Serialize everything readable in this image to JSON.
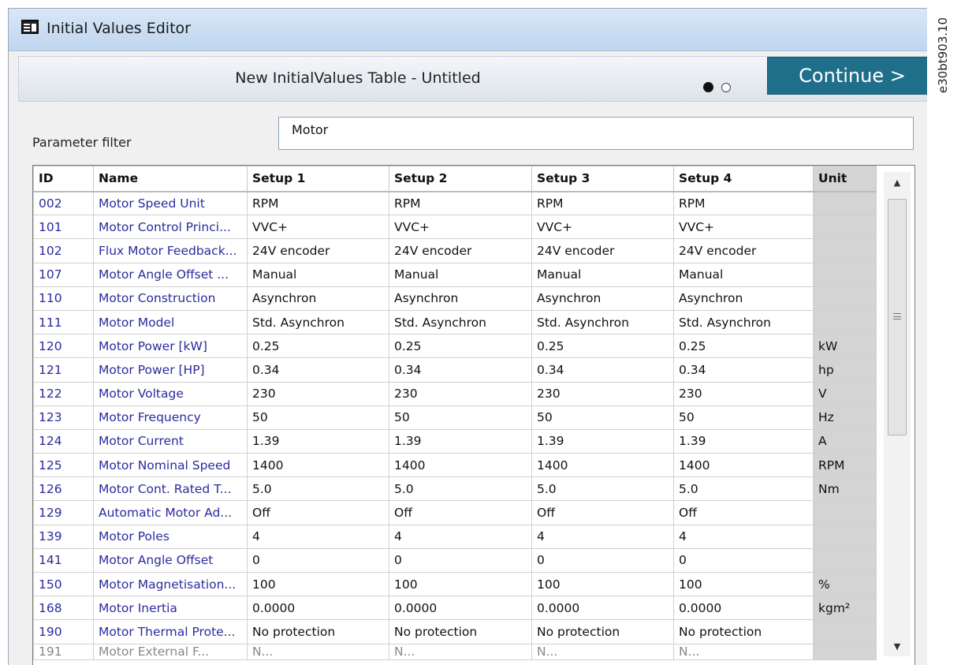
{
  "window": {
    "title": "Initial Values Editor",
    "icon": "table-app-icon"
  },
  "header": {
    "table_title": "New InitialValues Table - Untitled",
    "pagination": {
      "current_step": 1,
      "total_steps": 2
    },
    "continue_label": "Continue >",
    "continue_color": "#1f6f8b"
  },
  "filter": {
    "label": "Parameter filter",
    "value": "Motor"
  },
  "table": {
    "columns": [
      "ID",
      "Name",
      "Setup 1",
      "Setup 2",
      "Setup 3",
      "Setup 4",
      "Unit"
    ],
    "rows": [
      [
        "002",
        "Motor Speed Unit",
        "RPM",
        "RPM",
        "RPM",
        "RPM",
        ""
      ],
      [
        "101",
        "Motor Control Princi...",
        "VVC+",
        "VVC+",
        "VVC+",
        "VVC+",
        ""
      ],
      [
        "102",
        "Flux Motor Feedback...",
        "24V encoder",
        "24V encoder",
        "24V encoder",
        "24V encoder",
        ""
      ],
      [
        "107",
        "Motor Angle Offset ...",
        "Manual",
        "Manual",
        "Manual",
        "Manual",
        ""
      ],
      [
        "110",
        "Motor Construction",
        "Asynchron",
        "Asynchron",
        "Asynchron",
        "Asynchron",
        ""
      ],
      [
        "111",
        "Motor Model",
        "Std. Asynchron",
        "Std. Asynchron",
        "Std. Asynchron",
        "Std. Asynchron",
        ""
      ],
      [
        "120",
        "Motor Power [kW]",
        "0.25",
        "0.25",
        "0.25",
        "0.25",
        "kW"
      ],
      [
        "121",
        "Motor Power [HP]",
        "0.34",
        "0.34",
        "0.34",
        "0.34",
        "hp"
      ],
      [
        "122",
        "Motor Voltage",
        "230",
        "230",
        "230",
        "230",
        "V"
      ],
      [
        "123",
        "Motor Frequency",
        "50",
        "50",
        "50",
        "50",
        "Hz"
      ],
      [
        "124",
        "Motor Current",
        "1.39",
        "1.39",
        "1.39",
        "1.39",
        "A"
      ],
      [
        "125",
        "Motor Nominal Speed",
        "1400",
        "1400",
        "1400",
        "1400",
        "RPM"
      ],
      [
        "126",
        "Motor Cont. Rated T...",
        "5.0",
        "5.0",
        "5.0",
        "5.0",
        "Nm"
      ],
      [
        "129",
        "Automatic Motor Ad...",
        "Off",
        "Off",
        "Off",
        "Off",
        ""
      ],
      [
        "139",
        "Motor Poles",
        "4",
        "4",
        "4",
        "4",
        ""
      ],
      [
        "141",
        "Motor Angle Offset",
        "0",
        "0",
        "0",
        "0",
        ""
      ],
      [
        "150",
        "Motor Magnetisation...",
        "100",
        "100",
        "100",
        "100",
        "%"
      ],
      [
        "168",
        "Motor Inertia",
        "0.0000",
        "0.0000",
        "0.0000",
        "0.0000",
        "kgm²"
      ],
      [
        "190",
        "Motor Thermal Prote...",
        "No protection",
        "No protection",
        "No protection",
        "No protection",
        ""
      ]
    ],
    "partial_row": [
      "191",
      "Motor External F...",
      "N...",
      "N...",
      "N...",
      "N...",
      ""
    ]
  },
  "scrollbar": {
    "up_icon": "scroll-up-arrow-icon",
    "down_icon": "scroll-down-arrow-icon"
  },
  "figure_code": "e30bt903.10"
}
